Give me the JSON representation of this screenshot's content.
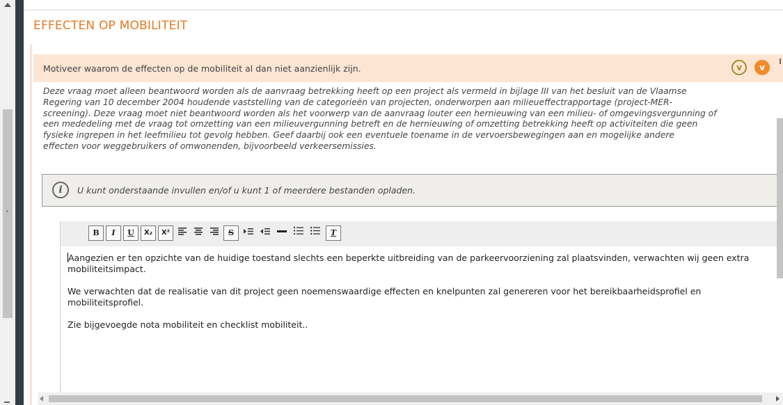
{
  "section": {
    "title": "EFFECTEN OP MOBILITEIT"
  },
  "question": {
    "text": "Motiveer waarom de effecten op de mobiliteit al dan niet aanzienlijk zijn.",
    "toggle_icon_label": "v",
    "collapse_icon_label": "v"
  },
  "explanation": {
    "lines": [
      "Deze vraag moet alleen beantwoord worden als de aanvraag betrekking heeft op een project als vermeld in bijlage III van het besluit van de Vlaamse",
      "Regering van 10 december 2004 houdende vaststelling van de categorieën van projecten, onderworpen aan milieueffectrapportage (project-MER-",
      "screening). Deze vraag moet niet beantwoord worden als het voorwerp van de aanvraag louter een hernieuwing van een milieu- of omgevingsvergunning of",
      "een mededeling met de vraag tot omzetting van een milieuvergunning betreft en de hernieuwing of omzetting betrekking heeft op activiteiten die geen",
      "fysieke ingrepen in het leefmilieu tot gevolg hebben. Geef daarbij ook een eventuele toename in de vervoersbewegingen aan en mogelijke andere",
      "effecten voor weggebruikers of omwonenden, bijvoorbeeld verkeersemissies."
    ]
  },
  "info": {
    "icon_glyph": "i",
    "text": "U kunt onderstaande invullen en/of u kunt 1 of meerdere bestanden opladen."
  },
  "toolbar": {
    "bold": "B",
    "italic": "I",
    "underline": "U",
    "subscript": "X₂",
    "superscript": "X²",
    "strike": "S",
    "remove_format": "T"
  },
  "editor": {
    "paragraphs": [
      "Aangezien er ten opzichte van de huidige toestand slechts een beperkte uitbreiding van de parkeervoorziening zal plaatsvinden, verwachten wij geen extra mobiliteitsimpact.",
      "We verwachten dat de realisatie van dit project geen noemenswaardige effecten en knelpunten zal genereren voor het bereikbaarheidsprofiel en mobiliteitsprofiel.",
      "Zie bijgevoegde nota mobiliteit en checklist mobiliteit.."
    ]
  },
  "colors": {
    "accent_orange": "#e57a24",
    "question_bg": "#fce5d3",
    "info_bg": "#efeeea",
    "dark_bar": "#2f3f45"
  }
}
